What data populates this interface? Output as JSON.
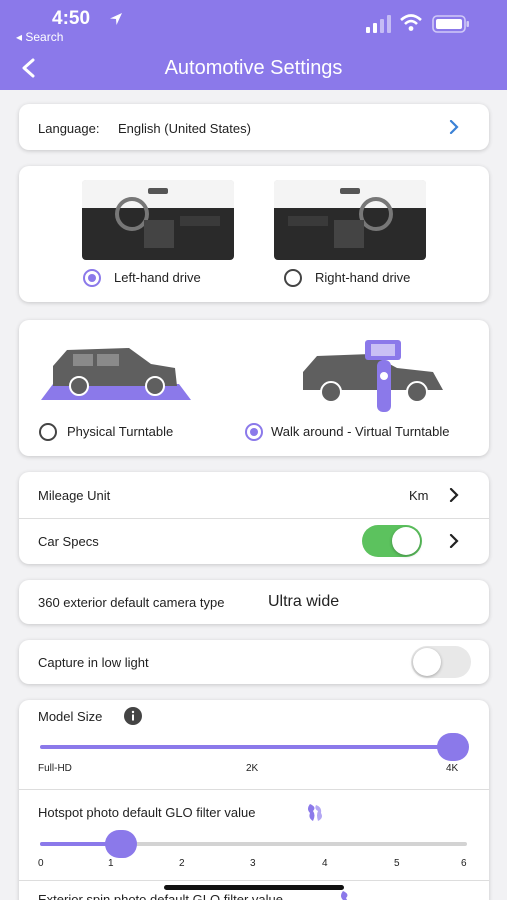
{
  "status": {
    "time": "4:50",
    "back_app": "◂ Search"
  },
  "nav": {
    "title": "Automotive Settings"
  },
  "language": {
    "label": "Language:",
    "value": "English (United States)"
  },
  "drive": {
    "options": [
      {
        "label": "Left-hand drive",
        "selected": true
      },
      {
        "label": "Right-hand drive",
        "selected": false
      }
    ]
  },
  "turntable": {
    "options": [
      {
        "label": "Physical Turntable",
        "selected": false
      },
      {
        "label": "Walk around - Virtual Turntable",
        "selected": true
      }
    ]
  },
  "mileage": {
    "label": "Mileage Unit",
    "value": "Km"
  },
  "car_specs": {
    "label": "Car Specs",
    "enabled": true
  },
  "camera": {
    "label": "360 exterior default camera type",
    "value": "Ultra wide"
  },
  "low_light": {
    "label": "Capture in low light",
    "enabled": false
  },
  "model_size": {
    "label": "Model Size",
    "ticks": [
      "Full-HD",
      "2K",
      "4K"
    ],
    "value": "4K"
  },
  "hotspot": {
    "label": "Hotspot photo default GLO filter value",
    "ticks": [
      "0",
      "1",
      "2",
      "3",
      "4",
      "5",
      "6"
    ],
    "value": 1
  },
  "exterior_spin": {
    "label": "Exterior spin photo default GLO filter value"
  },
  "colors": {
    "accent": "#8b79ea",
    "toggle_on": "#5cc25e",
    "toggle_off": "#e8e8e8"
  },
  "icons": [
    "location-arrow-icon",
    "signal-icon",
    "wifi-icon",
    "battery-icon",
    "back-chevron-icon",
    "chevron-right-icon",
    "info-icon",
    "glo-filter-icon"
  ]
}
